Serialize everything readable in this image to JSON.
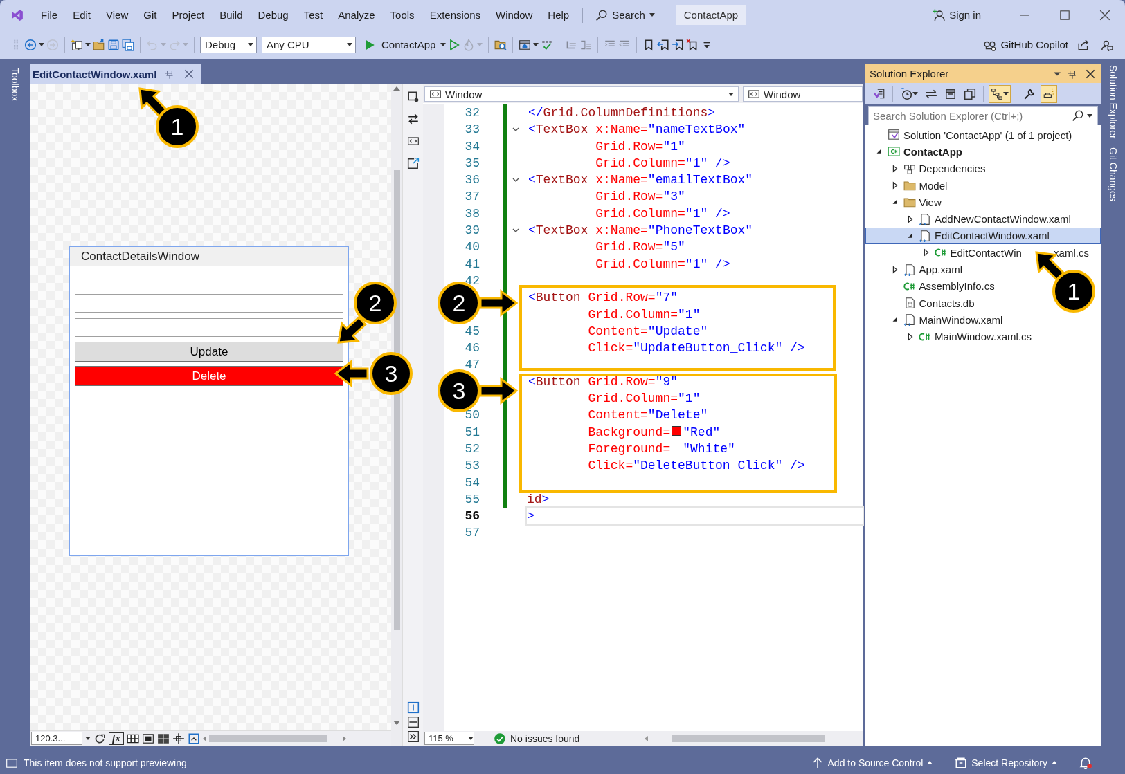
{
  "title_bar": {
    "menus": [
      "File",
      "Edit",
      "View",
      "Git",
      "Project",
      "Build",
      "Debug",
      "Test",
      "Analyze",
      "Tools",
      "Extensions",
      "Window",
      "Help"
    ],
    "search": "Search",
    "solution_name": "ContactApp",
    "sign_in": "Sign in"
  },
  "toolbar": {
    "items": [
      {
        "kind": "back",
        "disabled": false,
        "has_menu": true
      },
      {
        "kind": "forward",
        "disabled": true,
        "has_menu": false
      },
      {
        "kind": "separator"
      },
      {
        "kind": "new-item",
        "disabled": false,
        "has_menu": true
      },
      {
        "kind": "open",
        "disabled": false,
        "has_menu": false
      },
      {
        "kind": "save",
        "disabled": false,
        "has_menu": false
      },
      {
        "kind": "save-all",
        "disabled": false,
        "has_menu": false
      },
      {
        "kind": "separator"
      },
      {
        "kind": "undo",
        "disabled": true,
        "has_menu": true
      },
      {
        "kind": "redo",
        "disabled": true,
        "has_menu": true
      },
      {
        "kind": "separator"
      },
      {
        "kind": "combo",
        "value": "Debug",
        "wide": false
      },
      {
        "kind": "combo",
        "value": "Any CPU",
        "wide": true
      },
      {
        "kind": "run",
        "label": "ContactApp",
        "has_menu": true
      },
      {
        "kind": "run-without-debugging",
        "disabled": false,
        "has_menu": false
      },
      {
        "kind": "hot-reload",
        "disabled": true,
        "has_menu": true
      },
      {
        "kind": "separator"
      },
      {
        "kind": "find-in-files",
        "disabled": false,
        "has_menu": false
      },
      {
        "kind": "separator"
      },
      {
        "kind": "window",
        "disabled": false,
        "has_menu": true
      },
      {
        "kind": "spell-check",
        "disabled": false,
        "has_menu": false
      },
      {
        "kind": "separator"
      },
      {
        "kind": "comment",
        "disabled": true,
        "has_menu": false
      },
      {
        "kind": "uncomment",
        "disabled": true,
        "has_menu": false
      },
      {
        "kind": "separator"
      },
      {
        "kind": "indent",
        "disabled": true,
        "has_menu": false
      },
      {
        "kind": "outdent",
        "disabled": true,
        "has_menu": false
      },
      {
        "kind": "separator"
      },
      {
        "kind": "bookmark",
        "disabled": false,
        "has_menu": false
      },
      {
        "kind": "previous-bookmark",
        "disabled": false,
        "has_menu": false
      },
      {
        "kind": "next-bookmark",
        "disabled": false,
        "has_menu": false
      },
      {
        "kind": "clear-bookmarks",
        "disabled": false,
        "has_menu": false
      },
      {
        "kind": "overflow",
        "disabled": false,
        "has_menu": false
      }
    ],
    "copilot": "GitHub Copilot"
  },
  "side_tabs": {
    "left": [
      "Toolbox"
    ],
    "right": [
      "Solution Explorer",
      "Git Changes"
    ]
  },
  "document_tabs": [
    {
      "label": "EditContactWindow.xaml",
      "selected": true
    }
  ],
  "designer": {
    "preview": {
      "title": "ContactDetailsWindow",
      "fields": [
        {
          "kind": "textbox"
        },
        {
          "kind": "textbox"
        },
        {
          "kind": "textbox"
        }
      ],
      "buttons": [
        {
          "label": "Update",
          "color": "#dddddd"
        },
        {
          "label": "Delete",
          "color": "#ff0000"
        }
      ]
    },
    "zoom": "120.3...",
    "formula": "fx"
  },
  "code": {
    "scopes": [
      "Window",
      "Window"
    ],
    "zoom": "115 %",
    "issues": "No issues found",
    "lines": [
      {
        "number": "32",
        "kind": "tag",
        "changed": true,
        "foldable": false,
        "current": false,
        "tokens": [
          {
            "kind": "punct",
            "text": "</"
          },
          {
            "kind": "element",
            "text": "Grid.ColumnDefinitions"
          },
          {
            "kind": "punct",
            "text": ">"
          }
        ]
      },
      {
        "number": "33",
        "kind": "tag",
        "changed": true,
        "foldable": true,
        "current": false,
        "tokens": [
          {
            "kind": "punct",
            "text": "<"
          },
          {
            "kind": "element",
            "text": "TextBox"
          },
          {
            "kind": "attr",
            "text": " x:Name="
          },
          {
            "kind": "value",
            "text": "\"nameTextBox\""
          }
        ]
      },
      {
        "number": "34",
        "kind": "attribute",
        "changed": true,
        "foldable": false,
        "current": false,
        "tokens": [
          {
            "kind": "attr",
            "text": "Grid.Row="
          },
          {
            "kind": "value",
            "text": "\"1\""
          }
        ]
      },
      {
        "number": "35",
        "kind": "attribute",
        "changed": true,
        "foldable": false,
        "current": false,
        "tokens": [
          {
            "kind": "attr",
            "text": "Grid.Column="
          },
          {
            "kind": "value",
            "text": "\"1\""
          },
          {
            "kind": "punct",
            "text": " />"
          }
        ]
      },
      {
        "number": "36",
        "kind": "tag",
        "changed": true,
        "foldable": true,
        "current": false,
        "tokens": [
          {
            "kind": "punct",
            "text": "<"
          },
          {
            "kind": "element",
            "text": "TextBox"
          },
          {
            "kind": "attr",
            "text": " x:Name="
          },
          {
            "kind": "value",
            "text": "\"emailTextBox\""
          }
        ]
      },
      {
        "number": "37",
        "kind": "attribute",
        "changed": true,
        "foldable": false,
        "current": false,
        "tokens": [
          {
            "kind": "attr",
            "text": "Grid.Row="
          },
          {
            "kind": "value",
            "text": "\"3\""
          }
        ]
      },
      {
        "number": "38",
        "kind": "attribute",
        "changed": true,
        "foldable": false,
        "current": false,
        "tokens": [
          {
            "kind": "attr",
            "text": "Grid.Column="
          },
          {
            "kind": "value",
            "text": "\"1\""
          },
          {
            "kind": "punct",
            "text": " />"
          }
        ]
      },
      {
        "number": "39",
        "kind": "tag",
        "changed": true,
        "foldable": true,
        "current": false,
        "tokens": [
          {
            "kind": "punct",
            "text": "<"
          },
          {
            "kind": "element",
            "text": "TextBox"
          },
          {
            "kind": "attr",
            "text": " x:Name="
          },
          {
            "kind": "value",
            "text": "\"PhoneTextBox\""
          }
        ]
      },
      {
        "number": "40",
        "kind": "attribute",
        "changed": true,
        "foldable": false,
        "current": false,
        "tokens": [
          {
            "kind": "attr",
            "text": "Grid.Row="
          },
          {
            "kind": "value",
            "text": "\"5\""
          }
        ]
      },
      {
        "number": "41",
        "kind": "attribute",
        "changed": true,
        "foldable": false,
        "current": false,
        "tokens": [
          {
            "kind": "attr",
            "text": "Grid.Column="
          },
          {
            "kind": "value",
            "text": "\"1\""
          },
          {
            "kind": "punct",
            "text": " />"
          }
        ]
      },
      {
        "number": "42",
        "kind": "tag",
        "changed": true,
        "foldable": false,
        "current": false
      },
      {
        "kind": "tag",
        "changed": true,
        "foldable": false,
        "current": false,
        "tokens": [
          {
            "kind": "punct",
            "text": "<"
          },
          {
            "kind": "element",
            "text": "Button"
          },
          {
            "kind": "attr",
            "text": " Grid.Row="
          },
          {
            "kind": "value",
            "text": "\"7\""
          }
        ]
      },
      {
        "kind": "button-attribute",
        "changed": true,
        "foldable": false,
        "current": false,
        "tokens": [
          {
            "kind": "attr",
            "text": "Grid.Column="
          },
          {
            "kind": "value",
            "text": "\"1\""
          }
        ]
      },
      {
        "number": "45",
        "kind": "button-attribute",
        "changed": true,
        "foldable": false,
        "current": false,
        "tokens": [
          {
            "kind": "attr",
            "text": "Content="
          },
          {
            "kind": "value",
            "text": "\"Update\""
          }
        ]
      },
      {
        "number": "46",
        "kind": "button-attribute",
        "changed": true,
        "foldable": false,
        "current": false,
        "tokens": [
          {
            "kind": "attr",
            "text": "Click="
          },
          {
            "kind": "value",
            "text": "\"UpdateButton_Click\""
          },
          {
            "kind": "punct",
            "text": " />"
          }
        ]
      },
      {
        "number": "47",
        "kind": "tag",
        "changed": true,
        "foldable": false,
        "current": false
      },
      {
        "kind": "tag",
        "changed": true,
        "foldable": false,
        "current": false,
        "tokens": [
          {
            "kind": "punct",
            "text": "<"
          },
          {
            "kind": "element",
            "text": "Button"
          },
          {
            "kind": "attr",
            "text": " Grid.Row="
          },
          {
            "kind": "value",
            "text": "\"9\""
          }
        ]
      },
      {
        "kind": "button-attribute",
        "changed": true,
        "foldable": false,
        "current": false,
        "tokens": [
          {
            "kind": "attr",
            "text": "Grid.Column="
          },
          {
            "kind": "value",
            "text": "\"1\""
          }
        ]
      },
      {
        "number": "50",
        "kind": "button-attribute",
        "changed": true,
        "foldable": false,
        "current": false,
        "tokens": [
          {
            "kind": "attr",
            "text": "Content="
          },
          {
            "kind": "value",
            "text": "\"Delete\""
          }
        ]
      },
      {
        "number": "51",
        "kind": "button-attribute",
        "changed": true,
        "foldable": false,
        "current": false,
        "tokens": [
          {
            "kind": "attr",
            "text": "Background="
          },
          {
            "kind": "swatch",
            "color": "#ff0000"
          },
          {
            "kind": "value",
            "text": "\"Red\""
          }
        ]
      },
      {
        "number": "52",
        "kind": "button-attribute",
        "changed": true,
        "foldable": false,
        "current": false,
        "tokens": [
          {
            "kind": "attr",
            "text": "Foreground="
          },
          {
            "kind": "swatch",
            "color": "#ffffff"
          },
          {
            "kind": "value",
            "text": "\"White\""
          }
        ]
      },
      {
        "number": "53",
        "kind": "button-attribute",
        "changed": true,
        "foldable": false,
        "current": false,
        "tokens": [
          {
            "kind": "attr",
            "text": "Click="
          },
          {
            "kind": "value",
            "text": "\"DeleteButton_Click\""
          },
          {
            "kind": "punct",
            "text": " />"
          }
        ]
      },
      {
        "number": "54",
        "kind": "tag",
        "changed": true,
        "foldable": false,
        "current": false
      },
      {
        "number": "55",
        "kind": "cut",
        "changed": true,
        "foldable": false,
        "current": false,
        "tokens": [
          {
            "kind": "element",
            "text": "id"
          },
          {
            "kind": "punct",
            "text": ">"
          }
        ]
      },
      {
        "number": "56",
        "kind": "cut",
        "changed": false,
        "foldable": false,
        "current": true,
        "tokens": [
          {
            "kind": "punct",
            "text": ">"
          }
        ]
      },
      {
        "number": "57",
        "kind": "tag",
        "changed": false,
        "foldable": false,
        "current": false
      }
    ]
  },
  "solution_explorer": {
    "title": "Solution Explorer",
    "toolbar": [
      {
        "kind": "home",
        "on": false,
        "has_menu": false
      },
      {
        "kind": "separator"
      },
      {
        "kind": "pending-changes",
        "on": false,
        "has_menu": true
      },
      {
        "kind": "sync",
        "on": false,
        "has_menu": false
      },
      {
        "kind": "collapse-all",
        "on": false,
        "has_menu": false
      },
      {
        "kind": "copy-view",
        "on": false,
        "has_menu": false
      },
      {
        "kind": "separator"
      },
      {
        "kind": "tree-view",
        "on": true,
        "has_menu": true
      },
      {
        "kind": "separator"
      },
      {
        "kind": "properties",
        "on": false,
        "has_menu": false
      },
      {
        "kind": "preview",
        "on": true,
        "has_menu": false
      }
    ],
    "search": {
      "placeholder": "Search Solution Explorer (Ctrl+;)"
    },
    "tree": [
      {
        "label": "Solution 'ContactApp' (1 of 1 project)",
        "kind": "solution",
        "expandable": false,
        "selected": false
      },
      {
        "label": "ContactApp",
        "kind": "project",
        "expandable": true,
        "expanded": true,
        "selected": false,
        "children": [
          {
            "label": "Dependencies",
            "kind": "dependencies",
            "expandable": true,
            "expanded": false,
            "selected": false
          },
          {
            "label": "Model",
            "kind": "folder",
            "expandable": true,
            "expanded": false,
            "selected": false
          },
          {
            "label": "View",
            "kind": "folder",
            "expandable": true,
            "expanded": true,
            "selected": false,
            "children": [
              {
                "label": "AddNewContactWindow.xaml",
                "kind": "xaml",
                "expandable": true,
                "expanded": false,
                "selected": false
              },
              {
                "label": "EditContactWindow.xaml",
                "kind": "xaml",
                "expandable": true,
                "expanded": true,
                "selected": true,
                "children": [
                  {
                    "label": "EditContactWin",
                    "label_rest": ".xaml.cs",
                    "kind": "cs",
                    "expandable": true,
                    "expanded": false,
                    "selected": false
                  }
                ]
              }
            ]
          },
          {
            "label": "App.xaml",
            "kind": "xaml",
            "expandable": true,
            "expanded": false,
            "selected": false
          },
          {
            "label": "AssemblyInfo.cs",
            "kind": "cs",
            "expandable": false,
            "selected": false
          },
          {
            "label": "Contacts.db",
            "kind": "db",
            "expandable": false,
            "selected": false
          },
          {
            "label": "MainWindow.xaml",
            "kind": "xaml",
            "expandable": true,
            "expanded": true,
            "selected": false,
            "children": [
              {
                "label": "MainWindow.xaml.cs",
                "kind": "cs",
                "expandable": true,
                "expanded": false,
                "selected": false
              }
            ]
          }
        ]
      }
    ]
  },
  "status_bar": {
    "message": "This item does not support previewing",
    "source_control": "Add to Source Control",
    "repository": "Select Repository"
  },
  "annotations": [
    {
      "kind": "callout",
      "number": "1"
    },
    {
      "kind": "callout",
      "number": "2"
    },
    {
      "kind": "callout",
      "number": "3"
    },
    {
      "kind": "callout",
      "number": "2"
    },
    {
      "kind": "callout",
      "number": "3"
    },
    {
      "kind": "callout",
      "number": "1"
    }
  ]
}
